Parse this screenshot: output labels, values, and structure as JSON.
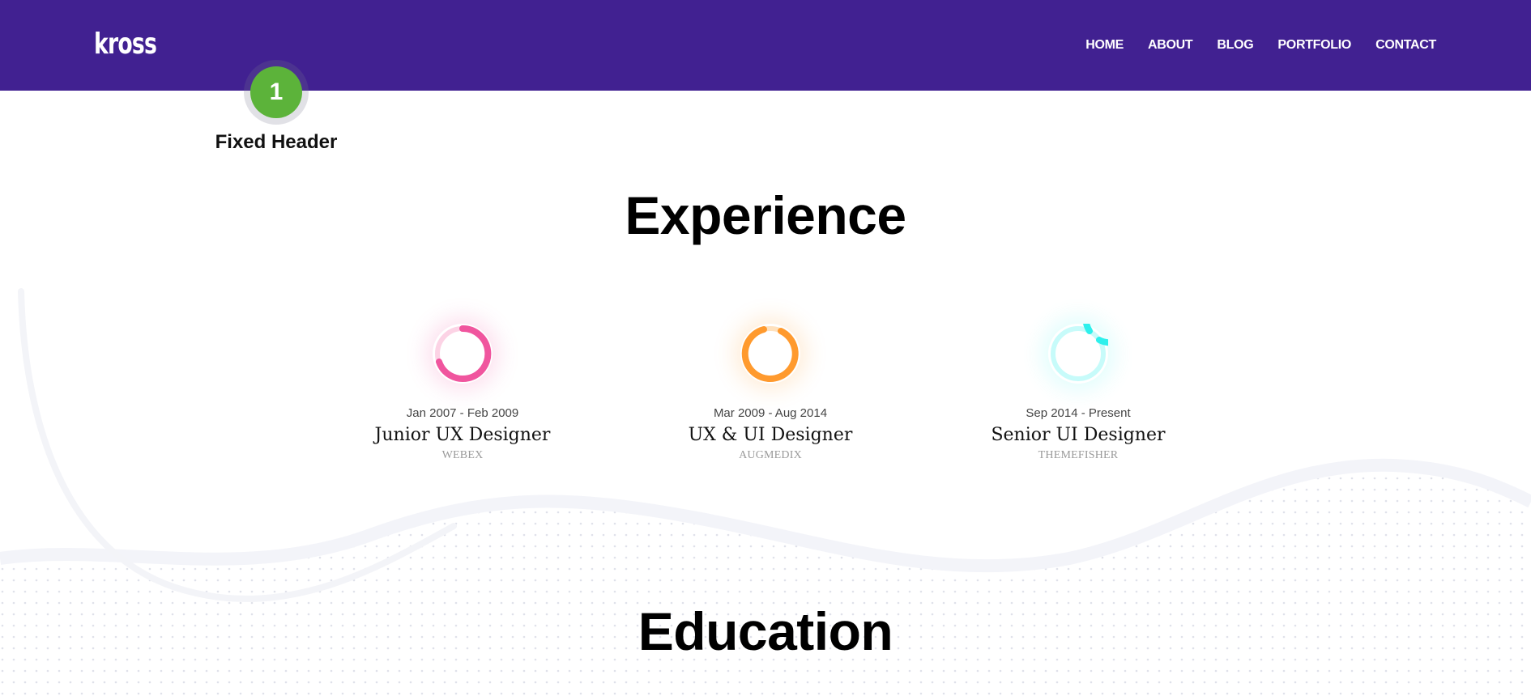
{
  "header": {
    "logo": "kross",
    "background": "#412191",
    "nav": [
      {
        "label": "HOME"
      },
      {
        "label": "ABOUT"
      },
      {
        "label": "BLOG"
      },
      {
        "label": "PORTFOLIO"
      },
      {
        "label": "CONTACT"
      }
    ]
  },
  "step": {
    "number": "1",
    "label": "Fixed Header",
    "color": "#5cb33a"
  },
  "experience": {
    "heading": "Experience",
    "items": [
      {
        "date": "Jan 2007 - Feb 2009",
        "role": "Junior UX Designer",
        "company": "WEBEX",
        "color": "#f0559e",
        "icon": "pink-ring-icon"
      },
      {
        "date": "Mar 2009 - Aug 2014",
        "role": "UX & UI Designer",
        "company": "AUGMEDIX",
        "color": "#ff9a2e",
        "icon": "orange-ring-icon"
      },
      {
        "date": "Sep 2014 - Present",
        "role": "Senior UI Designer",
        "company": "THEMEFISHER",
        "color": "#2ef0ec",
        "icon": "cyan-ring-icon"
      }
    ]
  },
  "education": {
    "heading": "Education"
  }
}
